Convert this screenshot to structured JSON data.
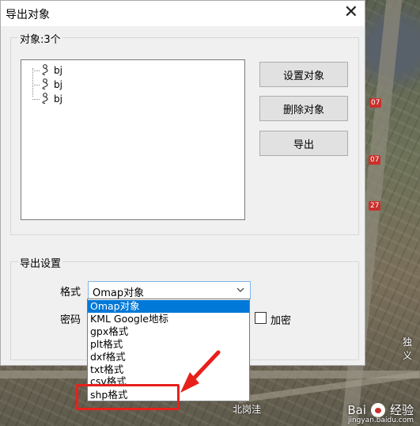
{
  "map": {
    "badges": [
      "07",
      "07",
      "27"
    ],
    "labels": [
      "独义",
      "北岗洼"
    ]
  },
  "watermark": {
    "brand": "Bai",
    "brand_suffix": "经验",
    "url": "jingyan.baidu.com"
  },
  "dialog": {
    "title": "导出对象",
    "close_glyph": "✕",
    "objects_group": {
      "label": "对象:3个",
      "items": [
        {
          "label": "bj"
        },
        {
          "label": "bj"
        },
        {
          "label": "bj"
        }
      ]
    },
    "buttons": {
      "set_objects": "设置对象",
      "delete_objects": "删除对象",
      "export": "导出"
    },
    "export_settings": {
      "label": "导出设置",
      "format_label": "格式",
      "format_value": "Omap对象",
      "password_label": "密码",
      "encrypt_label": "加密",
      "encrypt_checked": false
    },
    "format_options": [
      "Omap对象",
      "KML Google地标",
      "gpx格式",
      "plt格式",
      "dxf格式",
      "txt格式",
      "csv格式",
      "shp格式"
    ],
    "selected_index": 0,
    "highlighted_option": "shp格式"
  },
  "colors": {
    "selection": "#0078d7",
    "annotation": "#e8201c"
  }
}
